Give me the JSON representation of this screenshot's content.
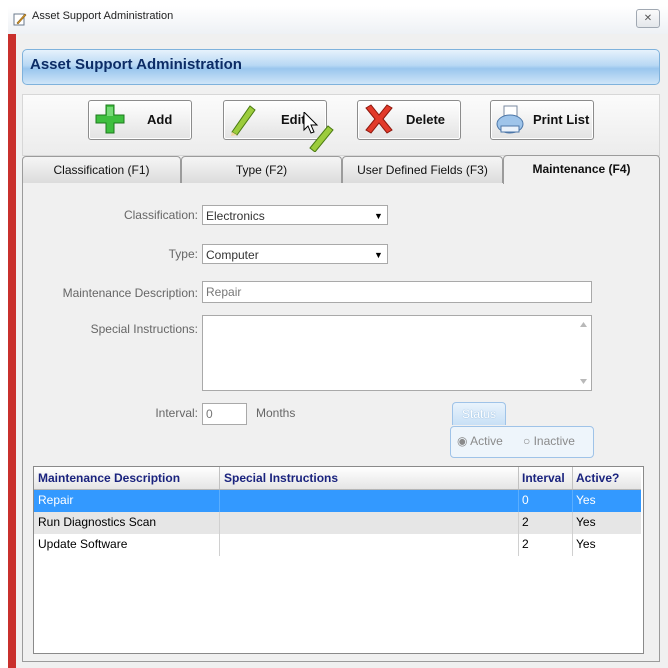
{
  "window": {
    "title": "Asset Support Administration",
    "close_glyph": "✕"
  },
  "header": {
    "title": "Asset Support Administration"
  },
  "toolbar": {
    "add_label": "Add",
    "edit_label": "Edit",
    "delete_label": "Delete",
    "print_label": "Print List"
  },
  "tabs": [
    {
      "label": "Classification (F1)",
      "active": false
    },
    {
      "label": "Type (F2)",
      "active": false
    },
    {
      "label": "User Defined Fields (F3)",
      "active": false
    },
    {
      "label": "Maintenance (F4)",
      "active": true
    }
  ],
  "form": {
    "classification_label": "Classification:",
    "classification_value": "Electronics",
    "type_label": "Type:",
    "type_value": "Computer",
    "description_label": "Maintenance Description:",
    "description_value": "Repair",
    "instructions_label": "Special Instructions:",
    "instructions_value": "",
    "interval_label": "Interval:",
    "interval_value": "0",
    "interval_unit": "Months",
    "status_label": "Status",
    "status_active": "Active",
    "status_inactive": "Inactive"
  },
  "grid": {
    "headers": [
      "Maintenance Description",
      "Special Instructions",
      "Interval",
      "Active?"
    ],
    "rows": [
      [
        "Repair",
        "",
        "0",
        "Yes"
      ],
      [
        "Run Diagnostics Scan",
        "",
        "2",
        "Yes"
      ],
      [
        "Update Software",
        "",
        "2",
        "Yes"
      ]
    ],
    "selected_row": 0
  },
  "colors": {
    "selection": "#3399ff",
    "header_text": "#0c2c66",
    "accent_border": "#c9302c"
  }
}
